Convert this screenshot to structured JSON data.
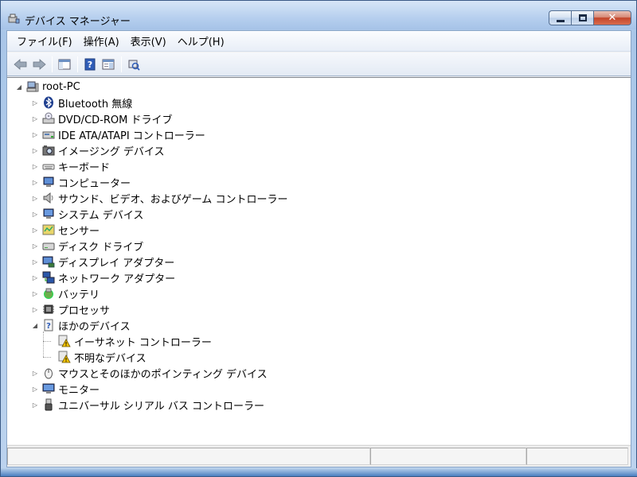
{
  "window": {
    "title": "デバイス マネージャー",
    "title_icon": "device-manager-icon"
  },
  "menubar": {
    "items": [
      {
        "label": "ファイル(F)"
      },
      {
        "label": "操作(A)"
      },
      {
        "label": "表示(V)"
      },
      {
        "label": "ヘルプ(H)"
      }
    ]
  },
  "toolbar": {
    "buttons": [
      {
        "name": "back-button",
        "icon": "back-arrow-icon"
      },
      {
        "name": "forward-button",
        "icon": "forward-arrow-icon"
      },
      {
        "name": "show-hide-console-tree-button",
        "icon": "console-tree-icon"
      },
      {
        "name": "help-button",
        "icon": "help-icon"
      },
      {
        "name": "properties-button",
        "icon": "properties-icon"
      },
      {
        "name": "scan-hardware-button",
        "icon": "scan-hardware-icon"
      }
    ]
  },
  "tree": {
    "root": {
      "label": "root-PC",
      "icon": "computer-root-icon",
      "expanded": true
    },
    "categories": [
      {
        "label": "Bluetooth 無線",
        "icon": "bluetooth-icon"
      },
      {
        "label": "DVD/CD-ROM ドライブ",
        "icon": "dvd-drive-icon"
      },
      {
        "label": "IDE ATA/ATAPI コントローラー",
        "icon": "ide-controller-icon"
      },
      {
        "label": "イメージング デバイス",
        "icon": "camera-icon"
      },
      {
        "label": "キーボード",
        "icon": "keyboard-icon"
      },
      {
        "label": "コンピューター",
        "icon": "computer-icon"
      },
      {
        "label": "サウンド、ビデオ、およびゲーム コントローラー",
        "icon": "speaker-icon"
      },
      {
        "label": "システム デバイス",
        "icon": "system-device-icon"
      },
      {
        "label": "センサー",
        "icon": "sensor-icon"
      },
      {
        "label": "ディスク ドライブ",
        "icon": "disk-drive-icon"
      },
      {
        "label": "ディスプレイ アダプター",
        "icon": "display-adapter-icon"
      },
      {
        "label": "ネットワーク アダプター",
        "icon": "network-adapter-icon"
      },
      {
        "label": "バッテリ",
        "icon": "battery-icon"
      },
      {
        "label": "プロセッサ",
        "icon": "processor-icon"
      },
      {
        "label": "ほかのデバイス",
        "icon": "unknown-device-icon",
        "expanded": true,
        "children": [
          {
            "label": "イーサネット コントローラー",
            "icon": "warning-device-icon"
          },
          {
            "label": "不明なデバイス",
            "icon": "warning-device-icon"
          }
        ]
      },
      {
        "label": "マウスとそのほかのポインティング デバイス",
        "icon": "mouse-icon"
      },
      {
        "label": "モニター",
        "icon": "monitor-icon"
      },
      {
        "label": "ユニバーサル シリアル バス コントローラー",
        "icon": "usb-icon"
      }
    ]
  },
  "colors": {
    "window_frame": "#a9c6e8",
    "close_button": "#c3452b",
    "tree_background": "#ffffff",
    "warning": "#f5c400"
  }
}
